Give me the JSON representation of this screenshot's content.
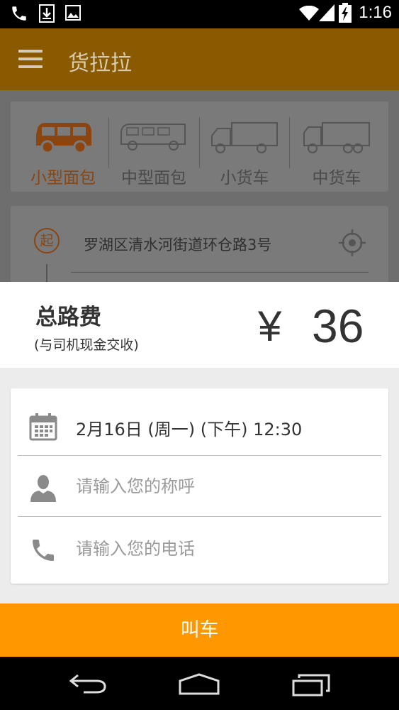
{
  "status_bar": {
    "time": "1:16",
    "left_icons": [
      "phone-icon",
      "download-icon",
      "image-icon"
    ],
    "right_icons": [
      "wifi-icon",
      "signal-icon",
      "battery-charging-icon"
    ]
  },
  "app_bar": {
    "title": "货拉拉",
    "menu_icon": "hamburger-menu-icon"
  },
  "vehicles": [
    {
      "label": "小型面包",
      "icon": "small-van-icon",
      "selected": true
    },
    {
      "label": "中型面包",
      "icon": "medium-van-icon",
      "selected": false
    },
    {
      "label": "小货车",
      "icon": "small-truck-icon",
      "selected": false
    },
    {
      "label": "中货车",
      "icon": "medium-truck-icon",
      "selected": false
    }
  ],
  "route": {
    "start_badge": "起",
    "start_address": "罗湖区清水河街道环仓路3号",
    "locate_icon": "locate-crosshair-icon"
  },
  "fee": {
    "title": "总路费",
    "subtitle": "(与司机现金交收)",
    "currency": "¥",
    "amount": "36"
  },
  "form": {
    "datetime": "2月16日 (周一) (下午) 12:30",
    "name_placeholder": "请输入您的称呼",
    "phone_placeholder": "请输入您的电话"
  },
  "call_button": {
    "label": "叫车"
  },
  "colors": {
    "accent": "#ff9800",
    "appbar_dimmed": "#8a5a00",
    "selected_vehicle": "#c85a1e"
  }
}
